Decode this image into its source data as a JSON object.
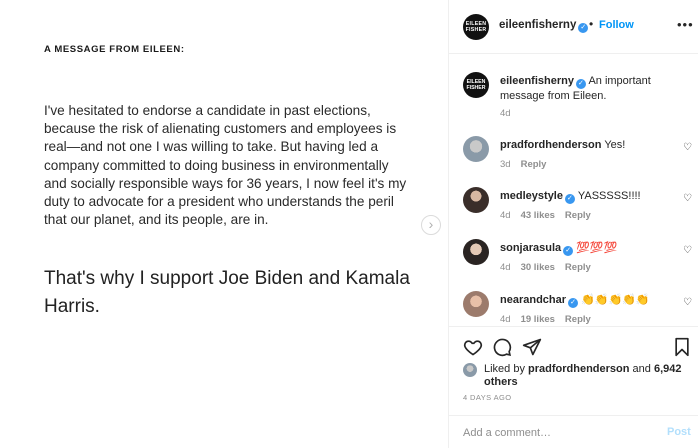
{
  "post": {
    "heading": "A MESSAGE FROM EILEEN:",
    "body": "I've hesitated to endorse a candidate in past elections, because the risk of alienating customers and employees is real—and not one I was willing to take. But having led a company committed to doing business in environmentally and socially responsible ways for 36 years, I now feel it's my duty to advocate for a president who understands the peril that our planet, and its people, are in.",
    "statement": "That's why I support Joe Biden and Kamala Harris.",
    "next_icon": "›"
  },
  "header": {
    "avatar_text": "EILEEN FISHER",
    "username": "eileenfisherny",
    "verified_icon": "✓",
    "dot": "•",
    "follow_label": "Follow",
    "more_icon": "•••"
  },
  "caption": {
    "avatar_text": "EILEEN FISHER",
    "username": "eileenfisherny",
    "text": "An important message from Eileen.",
    "age": "4d"
  },
  "comments": [
    {
      "user": "pradfordhenderson",
      "verified": false,
      "text": "Yes!",
      "age": "3d",
      "likes": "",
      "reply": "Reply"
    },
    {
      "user": "medleystyle",
      "verified": true,
      "text": "YASSSSS!!!!",
      "age": "4d",
      "likes": "43 likes",
      "reply": "Reply"
    },
    {
      "user": "sonjarasula",
      "verified": true,
      "text": "💯💯💯",
      "age": "4d",
      "likes": "30 likes",
      "reply": "Reply"
    },
    {
      "user": "nearandchar",
      "verified": true,
      "text": "👏👏👏👏👏",
      "age": "4d",
      "likes": "19 likes",
      "reply": "Reply"
    }
  ],
  "actions": {
    "like_icon": "heart-icon",
    "comment_icon": "comment-icon",
    "share_icon": "share-icon",
    "save_icon": "bookmark-icon"
  },
  "likes": {
    "prefix": "Liked by ",
    "user": "pradfordhenderson",
    "middle": " and ",
    "count": "6,942 others"
  },
  "timestamp": "4 DAYS AGO",
  "comment_input": {
    "placeholder": "Add a comment…",
    "post_label": "Post"
  },
  "colors": {
    "accent": "#0095f6",
    "verified": "#3897f0",
    "muted": "#8e8e8e",
    "post_disabled": "#b2dffc"
  }
}
